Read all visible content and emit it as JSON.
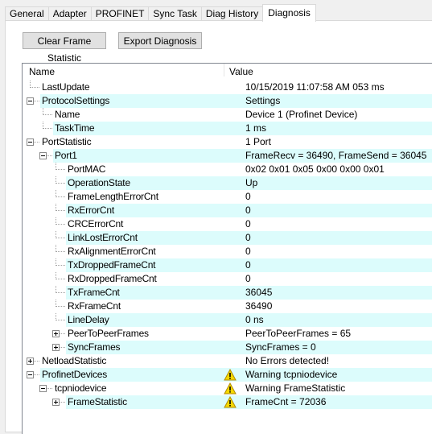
{
  "tabs": [
    {
      "label": "General",
      "active": false
    },
    {
      "label": "Adapter",
      "active": false
    },
    {
      "label": "PROFINET",
      "active": false
    },
    {
      "label": "Sync Task",
      "active": false
    },
    {
      "label": "Diag History",
      "active": false
    },
    {
      "label": "Diagnosis",
      "active": true
    }
  ],
  "toolbar": {
    "clear_label": "Clear Frame Statistic",
    "export_label": "Export Diagnosis"
  },
  "tree": {
    "columns": {
      "name": "Name",
      "value": "Value"
    },
    "colors": {
      "alt_row": "#dcfcfc",
      "warning": "#f5d800"
    },
    "rows": [
      {
        "name": "LastUpdate",
        "value": "10/15/2019 11:07:58 AM 053 ms",
        "level": 0,
        "expander": "none",
        "icon": ""
      },
      {
        "name": "ProtocolSettings",
        "value": "Settings",
        "level": 0,
        "expander": "minus",
        "icon": ""
      },
      {
        "name": "Name",
        "value": "Device 1 (Profinet Device)",
        "level": 1,
        "expander": "none",
        "icon": ""
      },
      {
        "name": "TaskTime",
        "value": "1 ms",
        "level": 1,
        "expander": "none",
        "icon": ""
      },
      {
        "name": "PortStatistic",
        "value": "1 Port",
        "level": 0,
        "expander": "minus",
        "icon": ""
      },
      {
        "name": "Port1",
        "value": "FrameRecv = 36490, FrameSend = 36045",
        "level": 1,
        "expander": "minus",
        "icon": ""
      },
      {
        "name": "PortMAC",
        "value": "0x02 0x01 0x05 0x00 0x00 0x01",
        "level": 2,
        "expander": "none",
        "icon": ""
      },
      {
        "name": "OperationState",
        "value": "Up",
        "level": 2,
        "expander": "none",
        "icon": ""
      },
      {
        "name": "FrameLengthErrorCnt",
        "value": "0",
        "level": 2,
        "expander": "none",
        "icon": ""
      },
      {
        "name": "RxErrorCnt",
        "value": "0",
        "level": 2,
        "expander": "none",
        "icon": ""
      },
      {
        "name": "CRCErrorCnt",
        "value": "0",
        "level": 2,
        "expander": "none",
        "icon": ""
      },
      {
        "name": "LinkLostErrorCnt",
        "value": "0",
        "level": 2,
        "expander": "none",
        "icon": ""
      },
      {
        "name": "RxAlignmentErrorCnt",
        "value": "0",
        "level": 2,
        "expander": "none",
        "icon": ""
      },
      {
        "name": "TxDroppedFrameCnt",
        "value": "0",
        "level": 2,
        "expander": "none",
        "icon": ""
      },
      {
        "name": "RxDroppedFrameCnt",
        "value": "0",
        "level": 2,
        "expander": "none",
        "icon": ""
      },
      {
        "name": "TxFrameCnt",
        "value": "36045",
        "level": 2,
        "expander": "none",
        "icon": ""
      },
      {
        "name": "RxFrameCnt",
        "value": "36490",
        "level": 2,
        "expander": "none",
        "icon": ""
      },
      {
        "name": "LineDelay",
        "value": "0 ns",
        "level": 2,
        "expander": "none",
        "icon": ""
      },
      {
        "name": "PeerToPeerFrames",
        "value": "PeerToPeerFrames = 65",
        "level": 2,
        "expander": "plus",
        "icon": ""
      },
      {
        "name": "SyncFrames",
        "value": "SyncFrames = 0",
        "level": 2,
        "expander": "plus",
        "icon": ""
      },
      {
        "name": "NetloadStatistic",
        "value": "No Errors detected!",
        "level": 0,
        "expander": "plus",
        "icon": ""
      },
      {
        "name": "ProfinetDevices",
        "value": "Warning tcpniodevice",
        "level": 0,
        "expander": "minus",
        "icon": "warning-icon"
      },
      {
        "name": "tcpniodevice",
        "value": "Warning FrameStatistic",
        "level": 1,
        "expander": "minus",
        "icon": "warning-icon"
      },
      {
        "name": "FrameStatistic",
        "value": "FrameCnt = 72036",
        "level": 2,
        "expander": "plus",
        "icon": "warning-icon"
      }
    ]
  }
}
